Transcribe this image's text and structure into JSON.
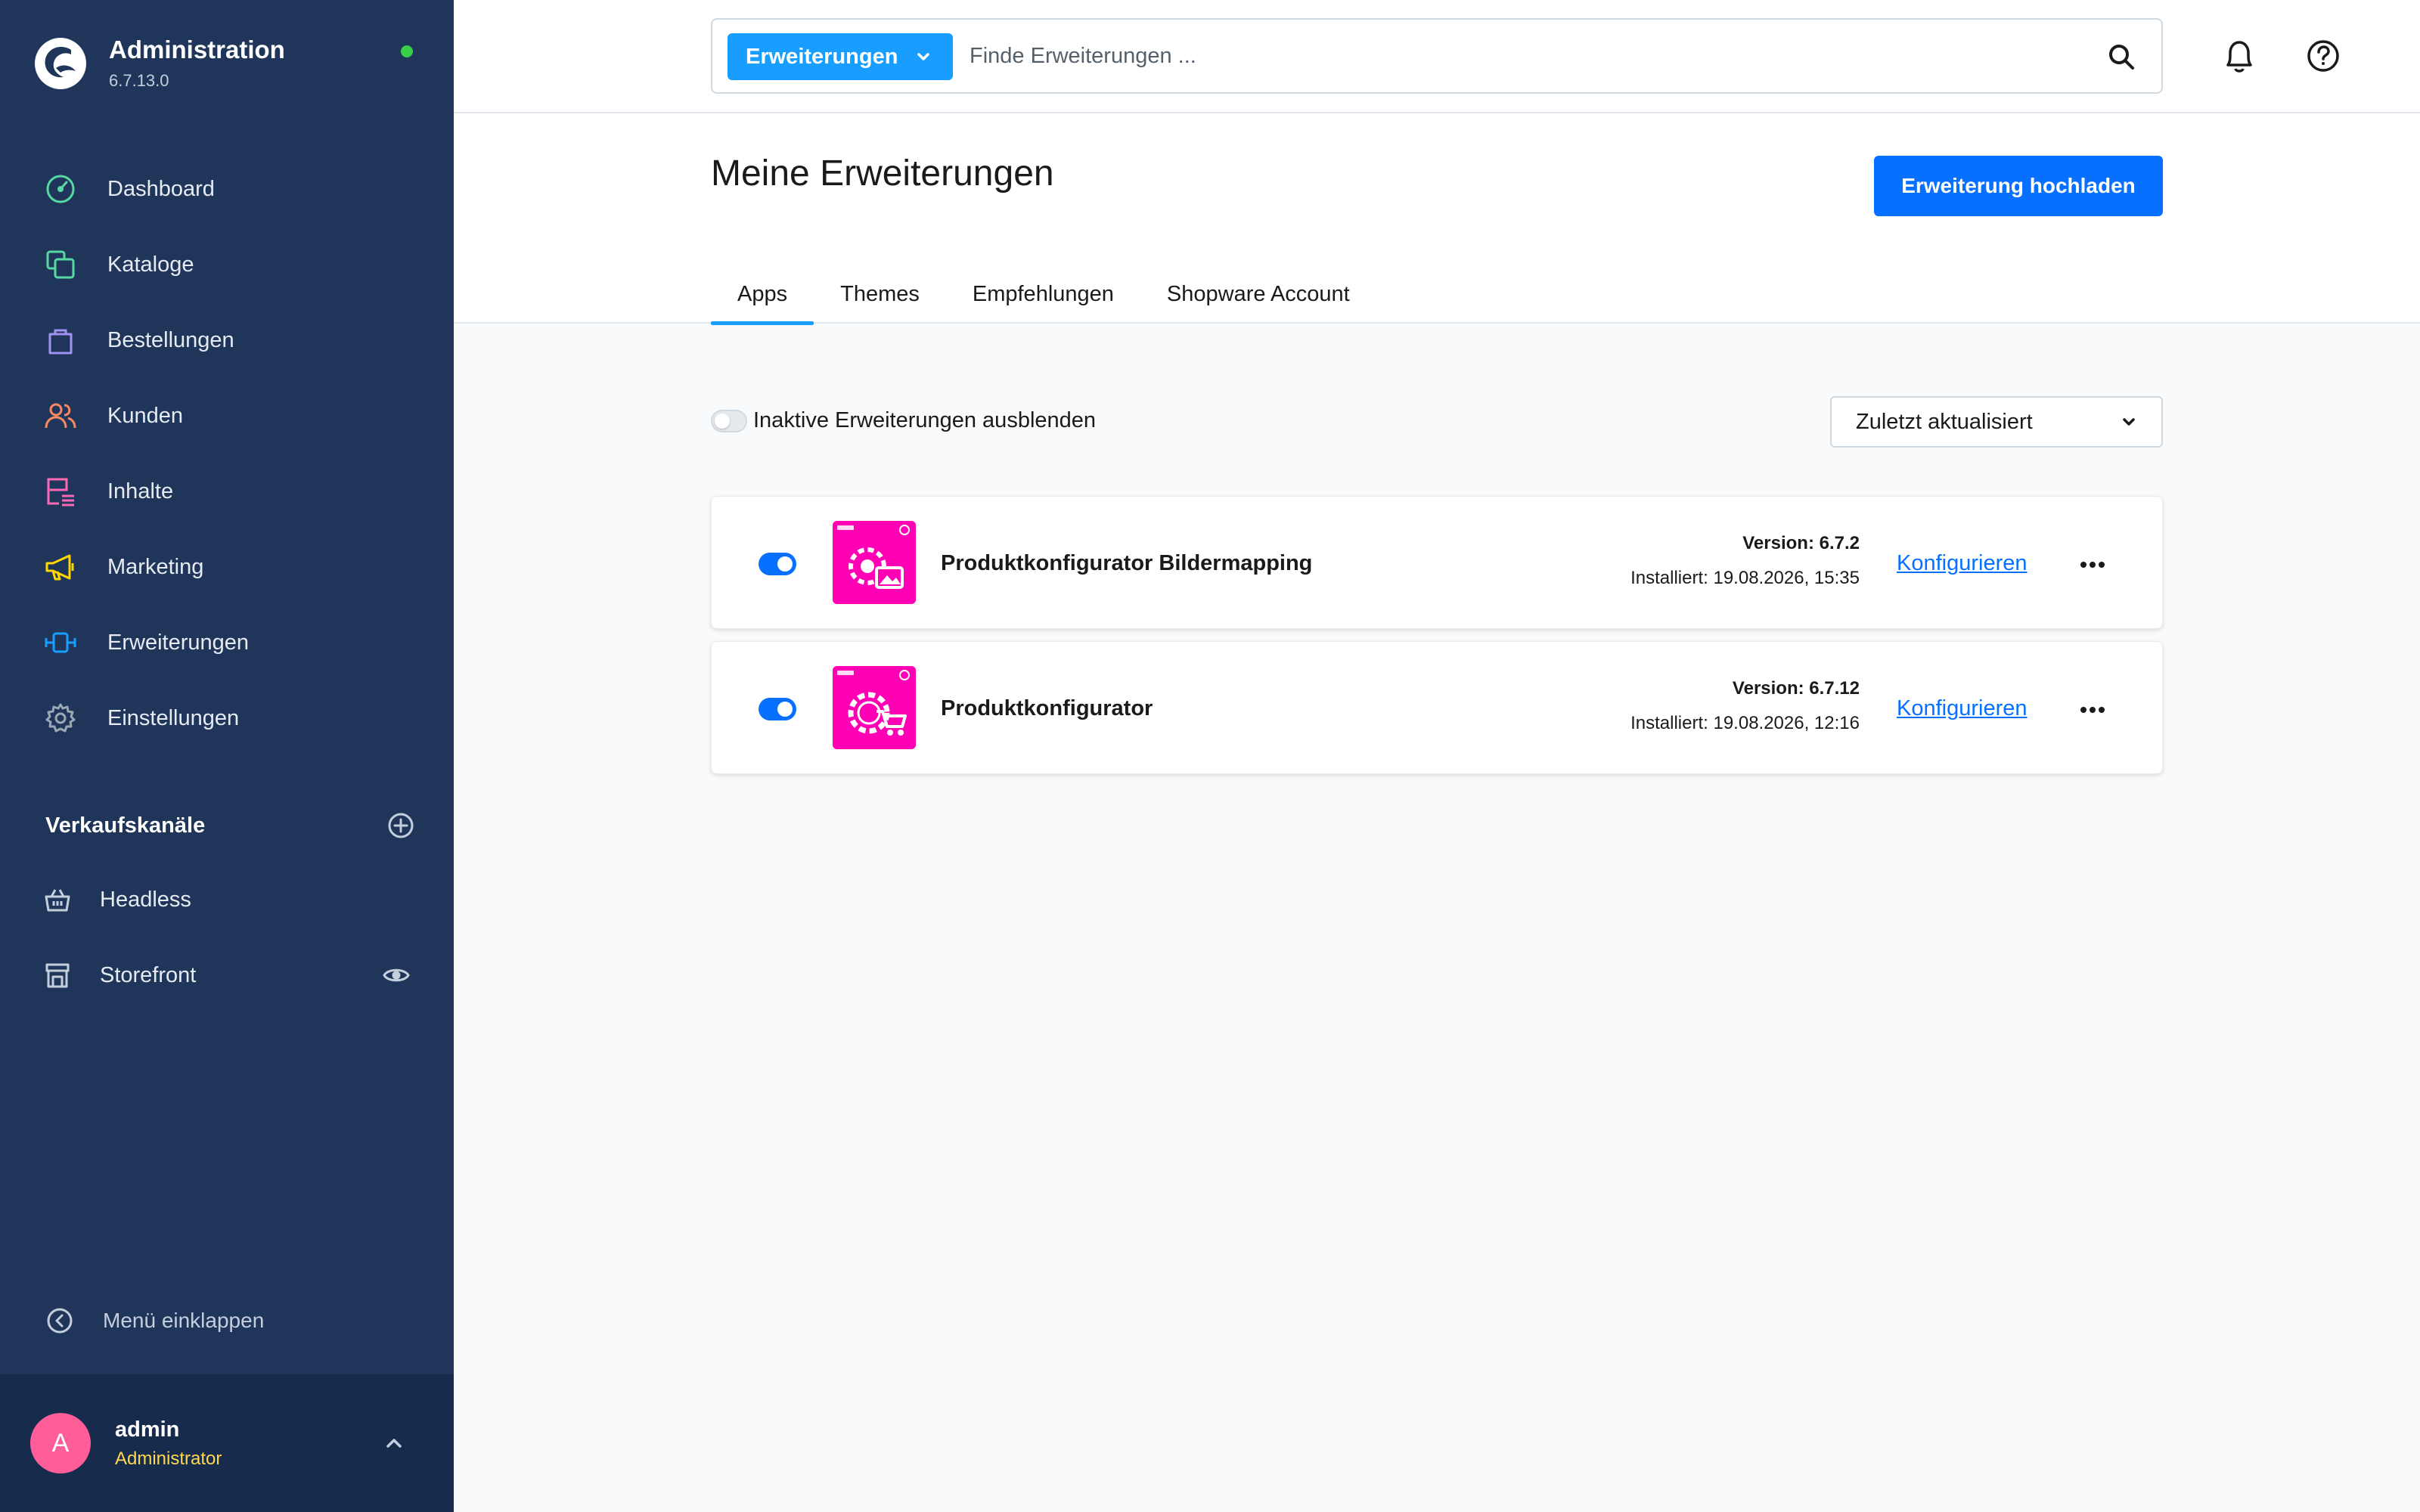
{
  "brand": {
    "title": "Administration",
    "version": "6.7.13.0"
  },
  "nav": [
    {
      "label": "Dashboard",
      "icon": "dashboard-icon",
      "color": "#57d9a3"
    },
    {
      "label": "Kataloge",
      "icon": "catalog-icon",
      "color": "#57d9a3"
    },
    {
      "label": "Bestellungen",
      "icon": "orders-icon",
      "color": "#a092f0"
    },
    {
      "label": "Kunden",
      "icon": "customers-icon",
      "color": "#f88962"
    },
    {
      "label": "Inhalte",
      "icon": "content-icon",
      "color": "#ff68b4"
    },
    {
      "label": "Marketing",
      "icon": "marketing-icon",
      "color": "#ffd700"
    },
    {
      "label": "Erweiterungen",
      "icon": "extensions-icon",
      "color": "#189eff"
    },
    {
      "label": "Einstellungen",
      "icon": "settings-icon",
      "color": "#9aa8b5"
    }
  ],
  "sales_channels": {
    "title": "Verkaufskanäle",
    "items": [
      {
        "label": "Headless",
        "icon": "basket-icon"
      },
      {
        "label": "Storefront",
        "icon": "storefront-icon"
      }
    ]
  },
  "collapse_label": "Menü einklappen",
  "user": {
    "initial": "A",
    "name": "admin",
    "role": "Administrator"
  },
  "search": {
    "type_label": "Erweiterungen",
    "placeholder": "Finde Erweiterungen ..."
  },
  "page": {
    "title": "Meine Erweiterungen",
    "upload_label": "Erweiterung hochladen"
  },
  "tabs": [
    {
      "label": "Apps",
      "active": true
    },
    {
      "label": "Themes",
      "active": false
    },
    {
      "label": "Empfehlungen",
      "active": false
    },
    {
      "label": "Shopware Account",
      "active": false
    }
  ],
  "filter": {
    "hide_inactive_label": "Inaktive Erweiterungen ausblenden",
    "sort_label": "Zuletzt aktualisiert"
  },
  "extensions": [
    {
      "name": "Produktkonfigurator Bildermapping",
      "version": "Version: 6.7.2",
      "installed": "Installiert: 19.08.2026, 15:35",
      "config_label": "Konfigurieren",
      "active": true
    },
    {
      "name": "Produktkonfigurator",
      "version": "Version: 6.7.12",
      "installed": "Installiert: 19.08.2026, 12:16",
      "config_label": "Konfigurieren",
      "active": true
    }
  ],
  "colors": {
    "sidebar_bg": "#1f3559",
    "accent": "#189eff",
    "primary_button": "#0870ff",
    "app_icon_bg": "#ff00b4",
    "status_online": "#37d046"
  }
}
